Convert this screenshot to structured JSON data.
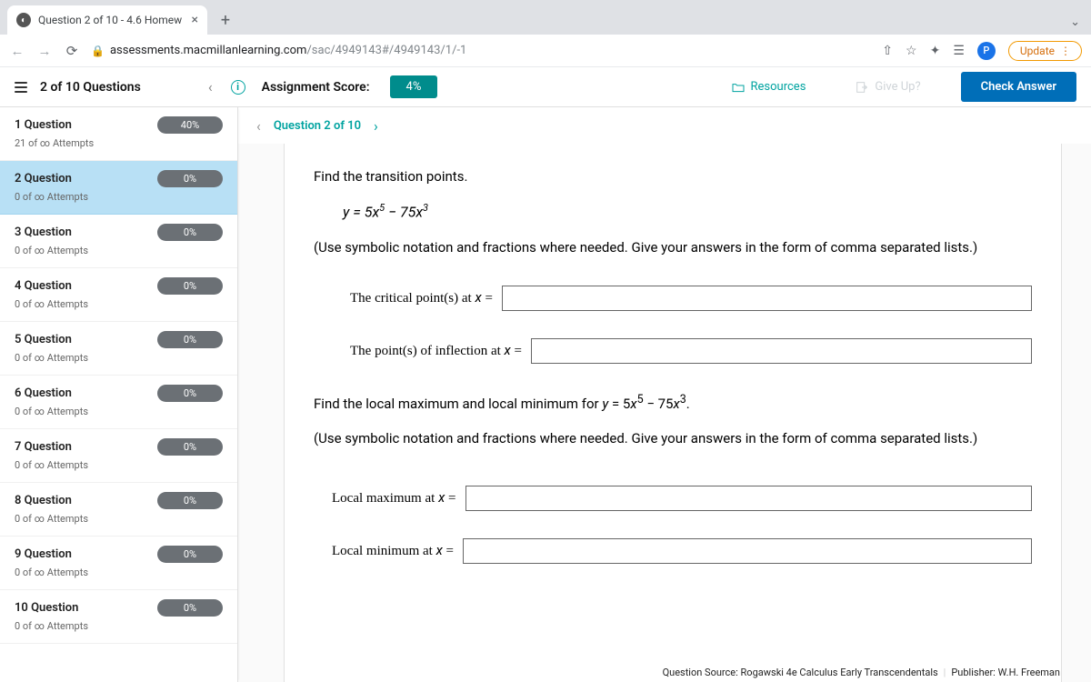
{
  "browser": {
    "tab_title": "Question 2 of 10 - 4.6 Homew",
    "url_domain": "assessments.macmillanlearning.com",
    "url_path": "/sac/4949143#/4949143/1/-1",
    "update_label": "Update",
    "profile_letter": "P"
  },
  "header": {
    "questions_label": "2 of 10 Questions",
    "score_label": "Assignment Score:",
    "score_value": "4%",
    "resources_label": "Resources",
    "giveup_label": "Give Up?",
    "check_label": "Check Answer"
  },
  "sidebar": {
    "items": [
      {
        "title": "1 Question",
        "pct": "40%",
        "attempts": "21 of ∞ Attempts"
      },
      {
        "title": "2 Question",
        "pct": "0%",
        "attempts": "0 of ∞ Attempts"
      },
      {
        "title": "3 Question",
        "pct": "0%",
        "attempts": "0 of ∞ Attempts"
      },
      {
        "title": "4 Question",
        "pct": "0%",
        "attempts": "0 of ∞ Attempts"
      },
      {
        "title": "5 Question",
        "pct": "0%",
        "attempts": "0 of ∞ Attempts"
      },
      {
        "title": "6 Question",
        "pct": "0%",
        "attempts": "0 of ∞ Attempts"
      },
      {
        "title": "7 Question",
        "pct": "0%",
        "attempts": "0 of ∞ Attempts"
      },
      {
        "title": "8 Question",
        "pct": "0%",
        "attempts": "0 of ∞ Attempts"
      },
      {
        "title": "9 Question",
        "pct": "0%",
        "attempts": "0 of ∞ Attempts"
      },
      {
        "title": "10 Question",
        "pct": "0%",
        "attempts": "0 of ∞ Attempts"
      }
    ],
    "active_index": 1
  },
  "question_nav": {
    "label": "Question 2 of 10"
  },
  "question": {
    "prompt1": "Find the transition points.",
    "equation_html": "y = 5x<sup>5</sup> − 75x<sup>3</sup>",
    "hint1": "(Use symbolic notation and fractions where needed. Give your answers in the form of comma separated lists.)",
    "ans1_label_html": "The critical point(s) at <span class='var'>x</span> =",
    "ans2_label_html": "The point(s) of inflection at <span class='var'>x</span> =",
    "prompt2_html": "Find the local maximum and local minimum for <span style='font-style:italic'>y</span> = 5<span style='font-style:italic'>x</span><sup>5</sup> − 75<span style='font-style:italic'>x</span><sup>3</sup>.",
    "hint2": "(Use symbolic notation and fractions where needed. Give your answers in the form of comma separated lists.)",
    "ans3_label_html": "Local maximum at <span class='var'>x</span> =",
    "ans4_label_html": "Local minimum at <span class='var'>x</span> ="
  },
  "footer": {
    "source": "Question Source: Rogawski 4e Calculus Early Transcendentals",
    "publisher": "Publisher: W.H. Freeman"
  }
}
